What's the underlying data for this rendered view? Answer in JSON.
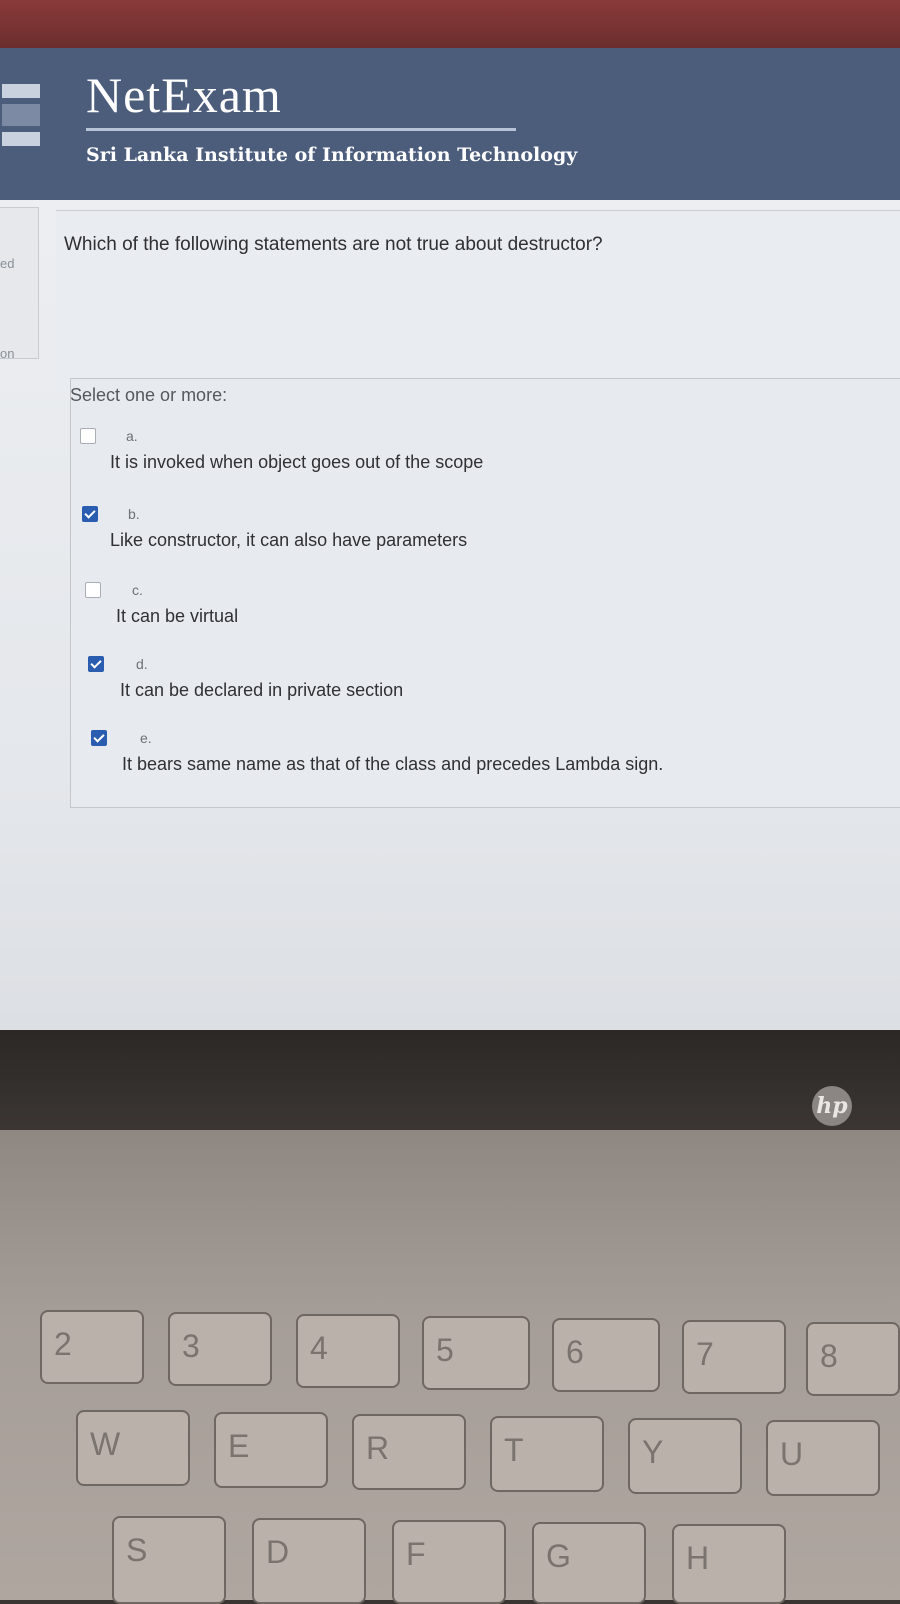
{
  "header": {
    "title": "NetExam",
    "subtitle": "Sri Lanka Institute of Information Technology"
  },
  "sidebar": {
    "labels": [
      "ed",
      "on"
    ]
  },
  "question": {
    "text": "Which of the following statements are not true about destructor?",
    "prompt": "Select one or more:",
    "options": [
      {
        "letter": "a.",
        "text": "It is invoked when object goes out of the scope",
        "checked": false
      },
      {
        "letter": "b.",
        "text": "Like constructor, it can also have parameters",
        "checked": true
      },
      {
        "letter": "c.",
        "text": "It can be virtual",
        "checked": false
      },
      {
        "letter": "d.",
        "text": "It can be declared in private section",
        "checked": true
      },
      {
        "letter": "e.",
        "text": "It bears same name as that of the class and precedes Lambda sign.",
        "checked": true
      }
    ]
  },
  "laptop": {
    "logo": "hp",
    "keys": [
      "2",
      "3",
      "4",
      "5",
      "6",
      "7",
      "8",
      "W",
      "E",
      "R",
      "T",
      "Y",
      "U",
      "S",
      "D",
      "F",
      "G",
      "H"
    ]
  }
}
